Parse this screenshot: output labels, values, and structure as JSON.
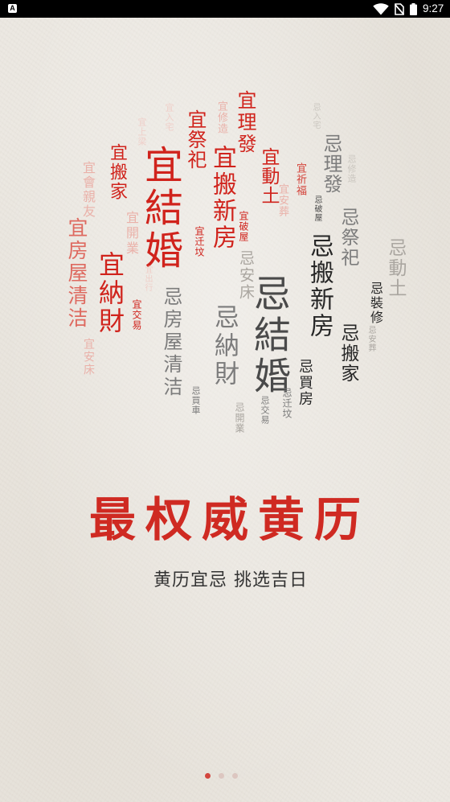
{
  "status_bar": {
    "notification_label": "A",
    "time": "9:27",
    "icons": {
      "notification": "app-notification-icon",
      "wifi": "wifi-icon",
      "sim": "no-sim-icon",
      "battery": "battery-icon"
    }
  },
  "theme": {
    "accent": "#cf2a22",
    "background": "#ece8e1",
    "text": "#333333",
    "inactive_dot": "#dcc6c0"
  },
  "word_cloud": {
    "yi": [
      "宜結婚",
      "宜搬新房",
      "宜理發",
      "宜祭祀",
      "宜動土",
      "宜搬家",
      "宜納財",
      "宜房屋清洁",
      "宜會親友",
      "宜開業",
      "宜迁坟",
      "宜破屋",
      "宜交易",
      "宜安葬",
      "宜祈福",
      "宜修造",
      "宜入宅",
      "宜上梁",
      "宜出行",
      "宜安床"
    ],
    "ji": [
      "忌結婚",
      "忌搬新房",
      "忌理發",
      "忌祭祀",
      "忌動土",
      "忌搬家",
      "忌買房",
      "忌裝修",
      "忌房屋清洁",
      "忌納財",
      "忌安床",
      "忌交易",
      "忌迁坟",
      "忌買車",
      "忌開業",
      "忌破屋",
      "忌安葬",
      "忌修造",
      "忌入宅"
    ]
  },
  "headline": "最权威黄历",
  "tagline": "黄历宜忌 挑选吉日",
  "pager": {
    "page_count": 3,
    "current_page": 1
  }
}
